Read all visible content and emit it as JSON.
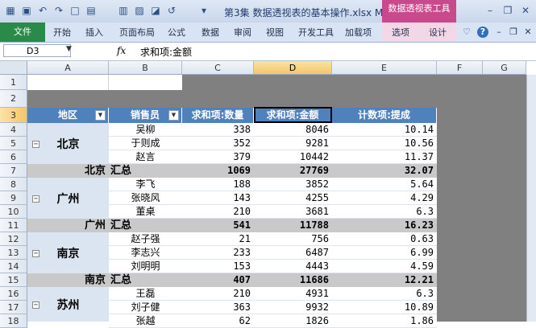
{
  "window": {
    "title": "第3集 数据透视表的基本操作.xlsx M",
    "context_tab": "数据透视表工具"
  },
  "ribbon": {
    "file_tab": "文件",
    "tabs": [
      "开始",
      "插入",
      "页面布局",
      "公式",
      "数据",
      "审阅",
      "视图",
      "开发工具",
      "加载项",
      "选项",
      "设计"
    ]
  },
  "formula_bar": {
    "name_box": "D3",
    "fx": "fx",
    "formula": "求和项:金额"
  },
  "columns": [
    "A",
    "B",
    "C",
    "D",
    "E",
    "F",
    "G"
  ],
  "rows": [
    "1",
    "2",
    "3",
    "4",
    "5",
    "6",
    "7",
    "8",
    "9",
    "10",
    "11",
    "12",
    "13",
    "14",
    "15",
    "16",
    "17",
    "18"
  ],
  "pivot": {
    "headers": [
      "地区",
      "销售员",
      "求和项:数量",
      "求和项:金额",
      "计数项:提成"
    ],
    "groups": [
      {
        "region": "北京",
        "subtotal_label": "北京 汇总",
        "rows": [
          [
            "吴柳",
            "338",
            "8046",
            "10.14"
          ],
          [
            "于则成",
            "352",
            "9281",
            "10.56"
          ],
          [
            "赵言",
            "379",
            "10442",
            "11.37"
          ]
        ],
        "subtotal": [
          "1069",
          "27769",
          "32.07"
        ]
      },
      {
        "region": "广州",
        "subtotal_label": "广州 汇总",
        "rows": [
          [
            "李飞",
            "188",
            "3852",
            "5.64"
          ],
          [
            "张晓风",
            "143",
            "4255",
            "4.29"
          ],
          [
            "董桌",
            "210",
            "3681",
            "6.3"
          ]
        ],
        "subtotal": [
          "541",
          "11788",
          "16.23"
        ]
      },
      {
        "region": "南京",
        "subtotal_label": "南京 汇总",
        "rows": [
          [
            "赵子强",
            "21",
            "756",
            "0.63"
          ],
          [
            "李志兴",
            "233",
            "6487",
            "6.99"
          ],
          [
            "刘明明",
            "153",
            "4443",
            "4.59"
          ]
        ],
        "subtotal": [
          "407",
          "11686",
          "12.21"
        ]
      },
      {
        "region": "苏州",
        "subtotal_label": "",
        "rows": [
          [
            "王磊",
            "210",
            "4931",
            "6.3"
          ],
          [
            "刘子健",
            "363",
            "9932",
            "10.89"
          ],
          [
            "张越",
            "62",
            "1826",
            "1.86"
          ]
        ],
        "subtotal": []
      }
    ]
  },
  "colors": {
    "header_blue": "#4f81bd",
    "region_fill": "#dbe5f1",
    "subtotal_grey": "#c9c9c9",
    "context_pink": "#c94a8c",
    "file_green": "#2a8a4a"
  }
}
